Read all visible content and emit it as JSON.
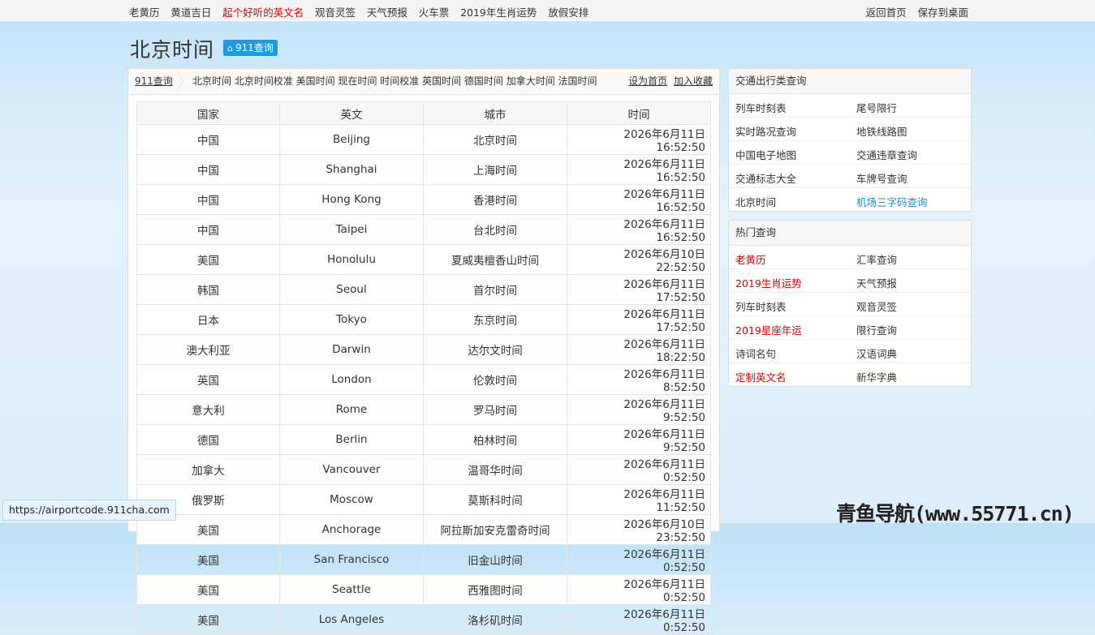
{
  "topnav": {
    "links": [
      {
        "label": "老黄历",
        "red": false
      },
      {
        "label": "黄道吉日",
        "red": false
      },
      {
        "label": "起个好听的英文名",
        "red": true
      },
      {
        "label": "观音灵签",
        "red": false
      },
      {
        "label": "天气预报",
        "red": false
      },
      {
        "label": "火车票",
        "red": false
      },
      {
        "label": "2019年生肖运势",
        "red": false
      },
      {
        "label": "放假安排",
        "red": false
      }
    ],
    "home_label": "返回首页",
    "desktop_label": "保存到桌面"
  },
  "page": {
    "title": "北京时间",
    "badge": "911查询"
  },
  "breadcrumb": {
    "home": "911查询",
    "keywords": "北京时间 北京时间校准 美国时间 现在时间 时间校准 英国时间 德国时间 加拿大时间 法国时间",
    "set_home": "设为首页",
    "bookmark": "加入收藏"
  },
  "table": {
    "headers": [
      "国家",
      "英文",
      "城市",
      "时间"
    ],
    "rows": [
      [
        "中国",
        "Beijing",
        "北京时间",
        "2026年6月11日　16:52:50"
      ],
      [
        "中国",
        "Shanghai",
        "上海时间",
        "2026年6月11日　16:52:50"
      ],
      [
        "中国",
        "Hong Kong",
        "香港时间",
        "2026年6月11日　16:52:50"
      ],
      [
        "中国",
        "Taipei",
        "台北时间",
        "2026年6月11日　16:52:50"
      ],
      [
        "美国",
        "Honolulu",
        "夏威夷檀香山时间",
        "2026年6月10日　22:52:50"
      ],
      [
        "韩国",
        "Seoul",
        "首尔时间",
        "2026年6月11日　17:52:50"
      ],
      [
        "日本",
        "Tokyo",
        "东京时间",
        "2026年6月11日　17:52:50"
      ],
      [
        "澳大利亚",
        "Darwin",
        "达尔文时间",
        "2026年6月11日　18:22:50"
      ],
      [
        "英国",
        "London",
        "伦敦时间",
        "2026年6月11日　 8:52:50"
      ],
      [
        "意大利",
        "Rome",
        "罗马时间",
        "2026年6月11日　 9:52:50"
      ],
      [
        "德国",
        "Berlin",
        "柏林时间",
        "2026年6月11日　 9:52:50"
      ],
      [
        "加拿大",
        "Vancouver",
        "温哥华时间",
        "2026年6月11日　 0:52:50"
      ],
      [
        "俄罗斯",
        "Moscow",
        "莫斯科时间",
        "2026年6月11日　11:52:50"
      ],
      [
        "美国",
        "Anchorage",
        "阿拉斯加安克雷奇时间",
        "2026年6月10日　23:52:50"
      ],
      [
        "美国",
        "San Francisco",
        "旧金山时间",
        "2026年6月11日　 0:52:50"
      ],
      [
        "美国",
        "Seattle",
        "西雅图时间",
        "2026年6月11日　 0:52:50"
      ],
      [
        "美国",
        "Los Angeles",
        "洛杉矶时间",
        "2026年6月11日　 0:52:50"
      ]
    ]
  },
  "sidebar": {
    "traffic": {
      "title": "交通出行类查询",
      "items": [
        {
          "label": "列车时刻表",
          "color": ""
        },
        {
          "label": "尾号限行",
          "color": ""
        },
        {
          "label": "实时路况查询",
          "color": ""
        },
        {
          "label": "地铁线路图",
          "color": ""
        },
        {
          "label": "中国电子地图",
          "color": ""
        },
        {
          "label": "交通违章查询",
          "color": ""
        },
        {
          "label": "交通标志大全",
          "color": ""
        },
        {
          "label": "车牌号查询",
          "color": ""
        },
        {
          "label": "北京时间",
          "color": ""
        },
        {
          "label": "机场三字码查询",
          "color": "blue"
        }
      ]
    },
    "hot": {
      "title": "热门查询",
      "items": [
        {
          "label": "老黄历",
          "color": "red"
        },
        {
          "label": "汇率查询",
          "color": ""
        },
        {
          "label": "2019生肖运势",
          "color": "red"
        },
        {
          "label": "天气预报",
          "color": ""
        },
        {
          "label": "列车时刻表",
          "color": ""
        },
        {
          "label": "观音灵签",
          "color": ""
        },
        {
          "label": "2019星座年运",
          "color": "red"
        },
        {
          "label": "限行查询",
          "color": ""
        },
        {
          "label": "诗词名句",
          "color": ""
        },
        {
          "label": "汉语词典",
          "color": ""
        },
        {
          "label": "定制英文名",
          "color": "red"
        },
        {
          "label": "新华字典",
          "color": ""
        }
      ]
    }
  },
  "statusbar": "https://airportcode.911cha.com",
  "watermark": "青鱼导航(www.55771.cn)"
}
